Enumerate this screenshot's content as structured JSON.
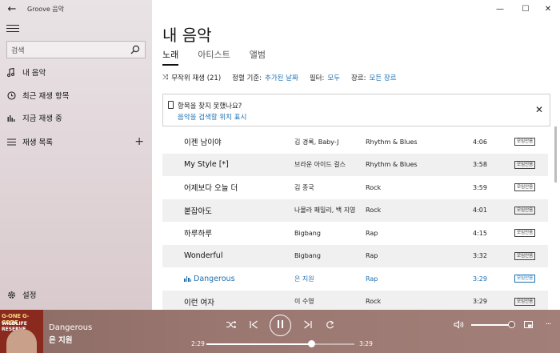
{
  "window": {
    "app_title": "Groove 음악",
    "back_glyph": "←",
    "minimize_glyph": "—",
    "maximize_glyph": "☐",
    "close_glyph": "✕"
  },
  "sidebar": {
    "search_placeholder": "검색",
    "items": [
      {
        "label": "내 음악",
        "icon": "music-note-icon"
      },
      {
        "label": "최근 재생 항목",
        "icon": "clock-icon"
      },
      {
        "label": "지금 재생 중",
        "icon": "bars-icon"
      },
      {
        "label": "재생 목록",
        "icon": "list-icon"
      }
    ],
    "playlist_add": "+",
    "settings_label": "설정"
  },
  "main": {
    "title": "내 음악",
    "tabs": [
      {
        "label": "노래",
        "active": true
      },
      {
        "label": "아티스트",
        "active": false
      },
      {
        "label": "앨범",
        "active": false
      }
    ],
    "toolbar": {
      "shuffle_label": "무작위 재생 (21)",
      "sort_label": "정렬 기준:",
      "sort_value": "추가된 날짜",
      "filter_label": "필터:",
      "filter_value": "모두",
      "genre_label": "장르:",
      "genre_value": "모든 장르"
    },
    "notice": {
      "question": "항목을 찾지 못했나요?",
      "link": "음악을 검색할 위치 표시",
      "close": "✕"
    },
    "songs": [
      {
        "title": "이젠 남이야",
        "artist": "김 경록, Baby-J",
        "genre": "Rhythm & Blues",
        "duration": "4:06",
        "badge": "모임안음"
      },
      {
        "title": "My Style [*]",
        "artist": "브라운 아이드 걸스",
        "genre": "Rhythm & Blues",
        "duration": "3:58",
        "badge": "모임안음"
      },
      {
        "title": "어제보다 오늘 더",
        "artist": "김 종국",
        "genre": "Rock",
        "duration": "3:59",
        "badge": "모임안음"
      },
      {
        "title": "붙잡아도",
        "artist": "나몰라 패밀리, 백 지영",
        "genre": "Rock",
        "duration": "4:01",
        "badge": "모임안음"
      },
      {
        "title": "하루하루",
        "artist": "Bigbang",
        "genre": "Rap",
        "duration": "4:15",
        "badge": "모임안음"
      },
      {
        "title": "Wonderful",
        "artist": "Bigbang",
        "genre": "Rap",
        "duration": "3:32",
        "badge": "모임안음"
      },
      {
        "title": "Dangerous",
        "artist": "은 지원",
        "genre": "Rap",
        "duration": "3:29",
        "badge": "모임안음",
        "playing": true
      },
      {
        "title": "이런 여자",
        "artist": "이 수영",
        "genre": "Rock",
        "duration": "3:29",
        "badge": "모임안음"
      }
    ]
  },
  "player": {
    "album_text_1": "G-ONE G-CODE",
    "album_text_2": "WILDLIFE RESERVE",
    "title": "Dangerous",
    "artist": "은 지원",
    "elapsed": "2:29",
    "total": "3:29",
    "progress": 0.71,
    "volume": 1.0,
    "more": "···"
  },
  "colors": {
    "accent": "#1a6fb3",
    "player_bg": "#9a7770"
  }
}
